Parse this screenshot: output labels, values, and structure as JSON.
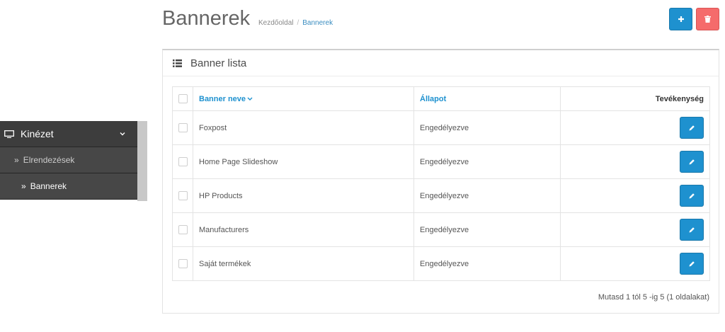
{
  "header": {
    "title": "Bannerek",
    "breadcrumb": [
      "Kezdőoldal",
      "Bannerek"
    ]
  },
  "sidebar": {
    "section": {
      "label": "Kinézet",
      "icon": "monitor-icon"
    },
    "items": [
      {
        "label": "Elrendezések",
        "active": false
      },
      {
        "label": "Bannerek",
        "active": true
      }
    ]
  },
  "panel": {
    "title": "Banner lista",
    "columns": {
      "name": "Banner neve",
      "status": "Állapot",
      "action": "Tevékenység"
    },
    "rows": [
      {
        "name": "Foxpost",
        "status": "Engedélyezve"
      },
      {
        "name": "Home Page Slideshow",
        "status": "Engedélyezve"
      },
      {
        "name": "HP Products",
        "status": "Engedélyezve"
      },
      {
        "name": "Manufacturers",
        "status": "Engedélyezve"
      },
      {
        "name": "Saját termékek",
        "status": "Engedélyezve"
      }
    ],
    "pagination": "Mutasd 1 tól 5 -ig 5 (1 oldalakat)"
  },
  "colors": {
    "primary": "#1e91cf",
    "danger": "#f56b6b",
    "sidebar": "#3d3d3d"
  }
}
